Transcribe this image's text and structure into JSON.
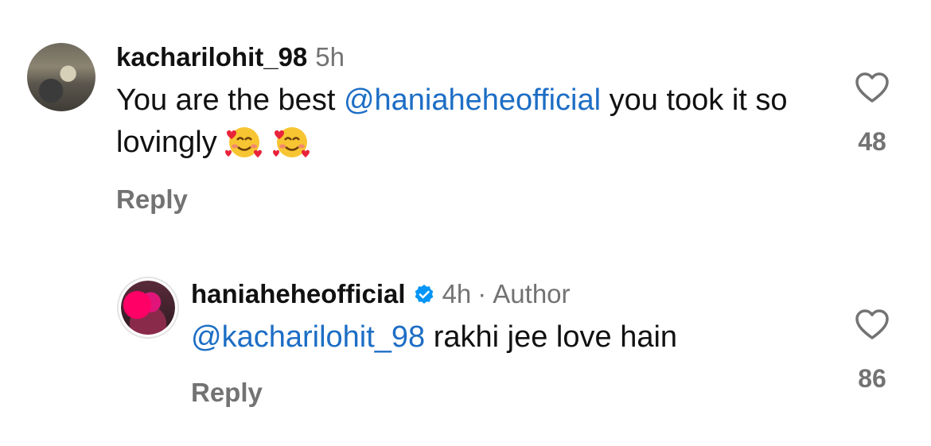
{
  "comments": [
    {
      "username": "kacharilohit_98",
      "time": "5h",
      "text_before": "You are the best ",
      "mention": "@haniaheheofficial",
      "text_after": " you took it so lovingly",
      "emoji": "smiling-face-with-hearts-icon",
      "reply_label": "Reply",
      "like_count": "48"
    },
    {
      "username": "haniaheheofficial",
      "verified": true,
      "time": "4h",
      "separator": "·",
      "author_label": "Author",
      "mention": "@kacharilohit_98",
      "text_after": " rakhi jee love hain",
      "reply_label": "Reply",
      "like_count": "86"
    }
  ],
  "colors": {
    "mention": "#1d6ec5",
    "muted": "#737373",
    "verified": "#0095f6"
  }
}
